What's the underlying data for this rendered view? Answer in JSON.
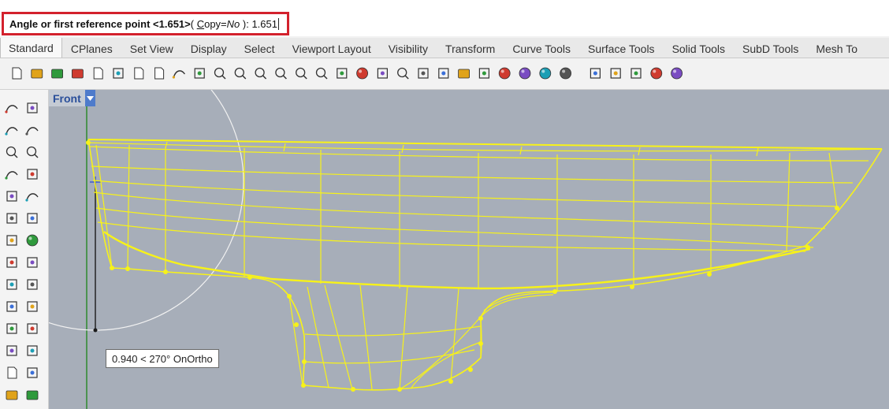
{
  "command_line": {
    "prompt_bold": "Angle or first reference point <1.651>",
    "option_open": "( ",
    "option_key_underlined": "C",
    "option_rest": "opy=",
    "option_value": "No",
    "option_close": " ):",
    "typed_value": " 1.651"
  },
  "tabs": [
    {
      "label": "Standard",
      "active": true
    },
    {
      "label": "CPlanes",
      "active": false
    },
    {
      "label": "Set View",
      "active": false
    },
    {
      "label": "Display",
      "active": false
    },
    {
      "label": "Select",
      "active": false
    },
    {
      "label": "Viewport Layout",
      "active": false
    },
    {
      "label": "Visibility",
      "active": false
    },
    {
      "label": "Transform",
      "active": false
    },
    {
      "label": "Curve Tools",
      "active": false
    },
    {
      "label": "Surface Tools",
      "active": false
    },
    {
      "label": "Solid Tools",
      "active": false
    },
    {
      "label": "SubD Tools",
      "active": false
    },
    {
      "label": "Mesh To",
      "active": false
    }
  ],
  "toolbar_icons": [
    "new-document-icon",
    "open-folder-icon",
    "save-icon",
    "print-icon",
    "import-icon",
    "cut-icon",
    "copy-icon",
    "paste-icon",
    "undo-icon",
    "pan-hand-icon",
    "rotate-view-icon",
    "zoom-icon",
    "zoom-window-icon",
    "zoom-extents-icon",
    "zoom-selected-icon",
    "undo-view-icon",
    "four-viewports-icon",
    "car-render-icon",
    "camera-icon",
    "history-icon",
    "snap-grid-icon",
    "light-bulb-icon",
    "lock-icon",
    "layer-material-icon",
    "color-wheel-icon",
    "sphere-shade-icon",
    "render-sphere-icon",
    "render-preview-icon",
    "options-icon",
    "gear-settings-icon",
    "grasshopper-icon",
    "globe-icon",
    "help-icon"
  ],
  "left_toolbar_icons": [
    "select-arrow-icon",
    "point-icon",
    "polyline-icon",
    "curve-points-icon",
    "circle-icon",
    "circle-center-icon",
    "arc-icon",
    "rectangle-icon",
    "ellipse-icon",
    "fillet-icon",
    "surface-icon",
    "sweep-icon",
    "box-icon",
    "sphere-icon",
    "mesh-plane-icon",
    "extrude-icon",
    "explode-icon",
    "trim-icon",
    "split-icon",
    "join-icon",
    "group-icon",
    "point-cloud-icon",
    "rebuild-icon",
    "control-points-icon",
    "text-icon",
    "dimension-icon",
    "block-icon",
    "blocks-insert-icon"
  ],
  "viewport": {
    "name": "Front",
    "background": "#a7aeb9",
    "curve_color": "#f7f219",
    "tooltip_text": "0.940 < 270° OnOrtho"
  },
  "colors": {
    "highlight_border": "#d3212d",
    "vp_title_text": "#2a4f9a",
    "vp_menu_bg": "#4e7bcb"
  }
}
